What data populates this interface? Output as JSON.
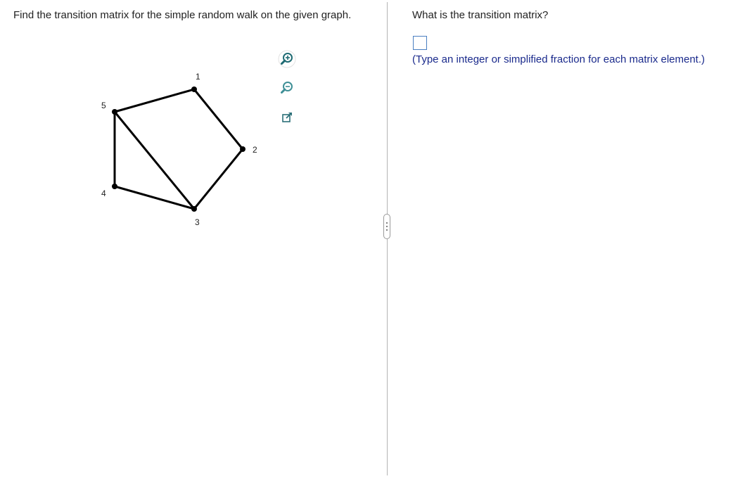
{
  "question": {
    "text": "Find the transition matrix for the simple random walk on the given graph."
  },
  "graph": {
    "vertices": [
      {
        "id": "1",
        "label": "1"
      },
      {
        "id": "2",
        "label": "2"
      },
      {
        "id": "3",
        "label": "3"
      },
      {
        "id": "4",
        "label": "4"
      },
      {
        "id": "5",
        "label": "5"
      }
    ],
    "edges": [
      [
        "1",
        "2"
      ],
      [
        "2",
        "3"
      ],
      [
        "3",
        "4"
      ],
      [
        "4",
        "5"
      ],
      [
        "5",
        "1"
      ],
      [
        "5",
        "3"
      ]
    ]
  },
  "toolbar": {
    "zoom_in_icon": "zoom-in-icon",
    "zoom_out_icon": "zoom-out-icon",
    "popout_icon": "popout-icon"
  },
  "answer": {
    "prompt": "What is the transition matrix?",
    "hint": "(Type an integer or simplified fraction for each matrix element.)",
    "value": ""
  },
  "colors": {
    "question_text": "#222222",
    "hint_text": "#1a2a8c",
    "answer_box_border": "#4a7fc1",
    "divider": "#b4b4b4"
  }
}
